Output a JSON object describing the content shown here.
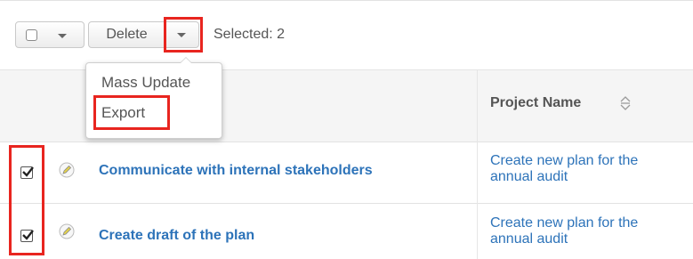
{
  "toolbar": {
    "delete_label": "Delete",
    "selected_text": "Selected: 2"
  },
  "dropdown_menu": {
    "items": [
      {
        "label": "Mass Update"
      },
      {
        "label": "Export"
      }
    ]
  },
  "table": {
    "columns": [
      {
        "label": ""
      },
      {
        "label": "Project Name"
      }
    ],
    "rows": [
      {
        "checked": true,
        "name": "Communicate with internal stakeholders",
        "project_line1": "Create new plan for the",
        "project_line2": "annual audit"
      },
      {
        "checked": true,
        "name": "Create draft of the plan",
        "project_line1": "Create new plan for the",
        "project_line2": "annual audit"
      }
    ]
  },
  "icons": {
    "select_all": "checkbox-icon",
    "dropdown_caret": "chevron-down-icon",
    "sort": "sort-icon",
    "edit": "pencil-icon",
    "row_check": "checkbox-checked-icon"
  },
  "colors": {
    "highlight": "#e8251f",
    "link": "#2d73b9",
    "header_bg": "#f5f5f5"
  }
}
